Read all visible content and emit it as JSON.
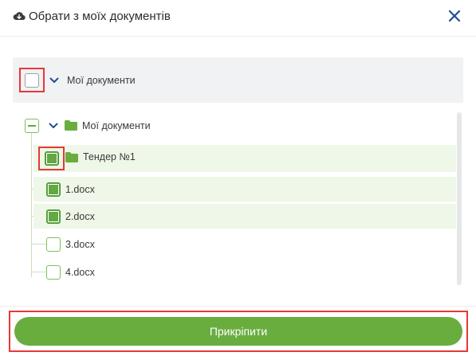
{
  "dialog": {
    "title": "Обрати з моїх документів"
  },
  "root": {
    "label": "Мої документи"
  },
  "tree": {
    "folder_label": "Мої документи",
    "subfolder_label": "Тендер №1",
    "files": [
      "1.docx",
      "2.docx",
      "3.docx",
      "4.docx"
    ]
  },
  "footer": {
    "attach_label": "Прикріпити"
  },
  "colors": {
    "accent": "#6aad3f",
    "checked": "#62a843",
    "selected_row": "#eef7e8",
    "highlight": "#e53935",
    "close_icon": "#1f4e96"
  },
  "icons": {
    "header": "cloud-download-icon",
    "close": "close-icon",
    "folder": "folder-icon",
    "expand": "chevron-down-icon"
  }
}
